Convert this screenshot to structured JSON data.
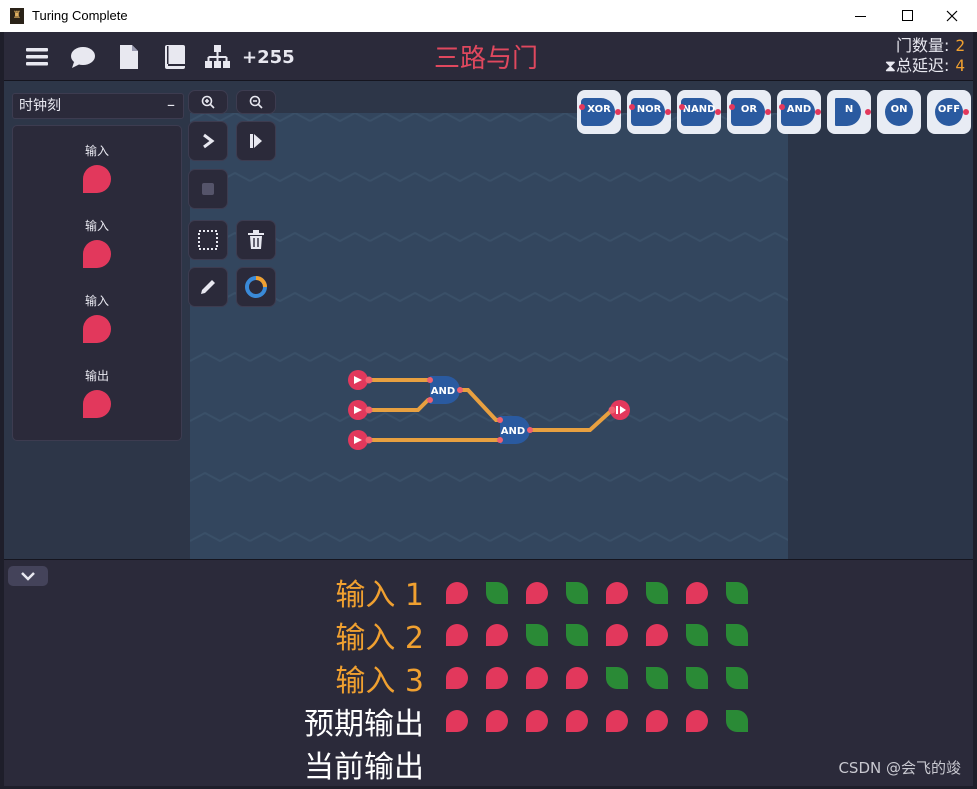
{
  "window": {
    "title": "Turing Complete"
  },
  "toolbar": {
    "credits": "+255",
    "level_title": "三路与门",
    "gate_count_label": "门数量:",
    "gate_count_value": "2",
    "delay_label": "总延迟:",
    "delay_value": "4"
  },
  "left_panel": {
    "tab_label": "时钟刻",
    "components": [
      "输入",
      "输入",
      "输入",
      "输出"
    ]
  },
  "gates": [
    "XOR",
    "NOR",
    "NAND",
    "OR",
    "AND",
    "N",
    "ON",
    "OFF"
  ],
  "circuit": {
    "gate_label": "AND"
  },
  "truth_table": {
    "rows": [
      {
        "label": "输入 1",
        "kind": "input",
        "values": [
          0,
          1,
          0,
          1,
          0,
          1,
          0,
          1
        ]
      },
      {
        "label": "输入 2",
        "kind": "input",
        "values": [
          0,
          0,
          1,
          1,
          0,
          0,
          1,
          1
        ]
      },
      {
        "label": "输入 3",
        "kind": "input",
        "values": [
          0,
          0,
          0,
          0,
          1,
          1,
          1,
          1
        ]
      },
      {
        "label": "预期输出",
        "kind": "output",
        "values": [
          0,
          0,
          0,
          0,
          0,
          0,
          0,
          1
        ]
      },
      {
        "label": "当前输出",
        "kind": "output",
        "values": []
      }
    ]
  },
  "watermark": "CSDN @会飞的竣",
  "colors": {
    "accent_red": "#e2385c",
    "accent_orange": "#f0a030",
    "green": "#2a8a36",
    "gate_blue": "#2a5aa0"
  }
}
